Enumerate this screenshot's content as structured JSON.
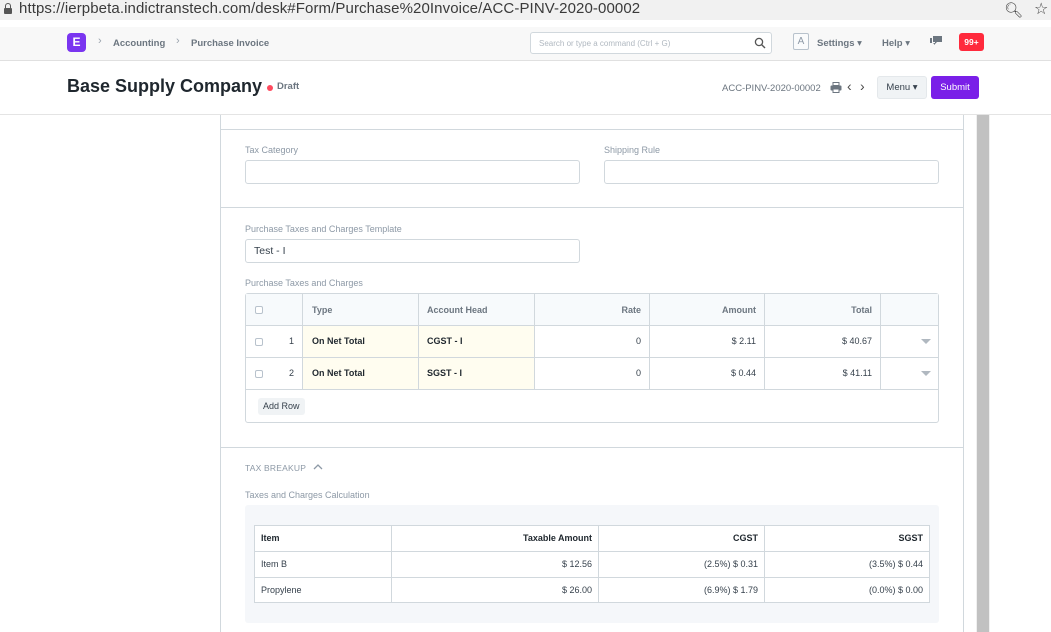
{
  "browser": {
    "url": "https://ierpbeta.indictranstech.com/desk#Form/Purchase%20Invoice/ACC-PINV-2020-00002"
  },
  "navbar": {
    "logo": "E",
    "breadcrumbs": [
      "Accounting",
      "Purchase Invoice"
    ],
    "search_placeholder": "Search or type a command (Ctrl + G)",
    "avatar": "A",
    "settings": "Settings",
    "help": "Help",
    "notifications": "99+"
  },
  "header": {
    "title": "Base Supply Company",
    "status": "Draft",
    "doc_name": "ACC-PINV-2020-00002",
    "menu": "Menu",
    "submit": "Submit"
  },
  "form": {
    "tax_category_label": "Tax Category",
    "tax_category_value": "",
    "shipping_rule_label": "Shipping Rule",
    "shipping_rule_value": "",
    "template_label": "Purchase Taxes and Charges Template",
    "template_value": "Test - I",
    "taxes_label": "Purchase Taxes and Charges"
  },
  "taxes_table": {
    "headers": [
      "Type",
      "Account Head",
      "Rate",
      "Amount",
      "Total"
    ],
    "rows": [
      {
        "idx": "1",
        "type": "On Net Total",
        "account": "CGST - I",
        "rate": "0",
        "amount": "$ 2.11",
        "total": "$ 40.67"
      },
      {
        "idx": "2",
        "type": "On Net Total",
        "account": "SGST - I",
        "rate": "0",
        "amount": "$ 0.44",
        "total": "$ 41.11"
      }
    ],
    "add_row": "Add Row"
  },
  "tax_breakup": {
    "title": "TAX BREAKUP",
    "calc_label": "Taxes and Charges Calculation",
    "headers": [
      "Item",
      "Taxable Amount",
      "CGST",
      "SGST"
    ],
    "rows": [
      {
        "item": "Item B",
        "taxable": "$ 12.56",
        "cgst": "(2.5%) $ 0.31",
        "sgst": "(3.5%) $ 0.44"
      },
      {
        "item": "Propylene",
        "taxable": "$ 26.00",
        "cgst": "(6.9%) $ 1.79",
        "sgst": "(0.0%) $ 0.00"
      }
    ]
  }
}
